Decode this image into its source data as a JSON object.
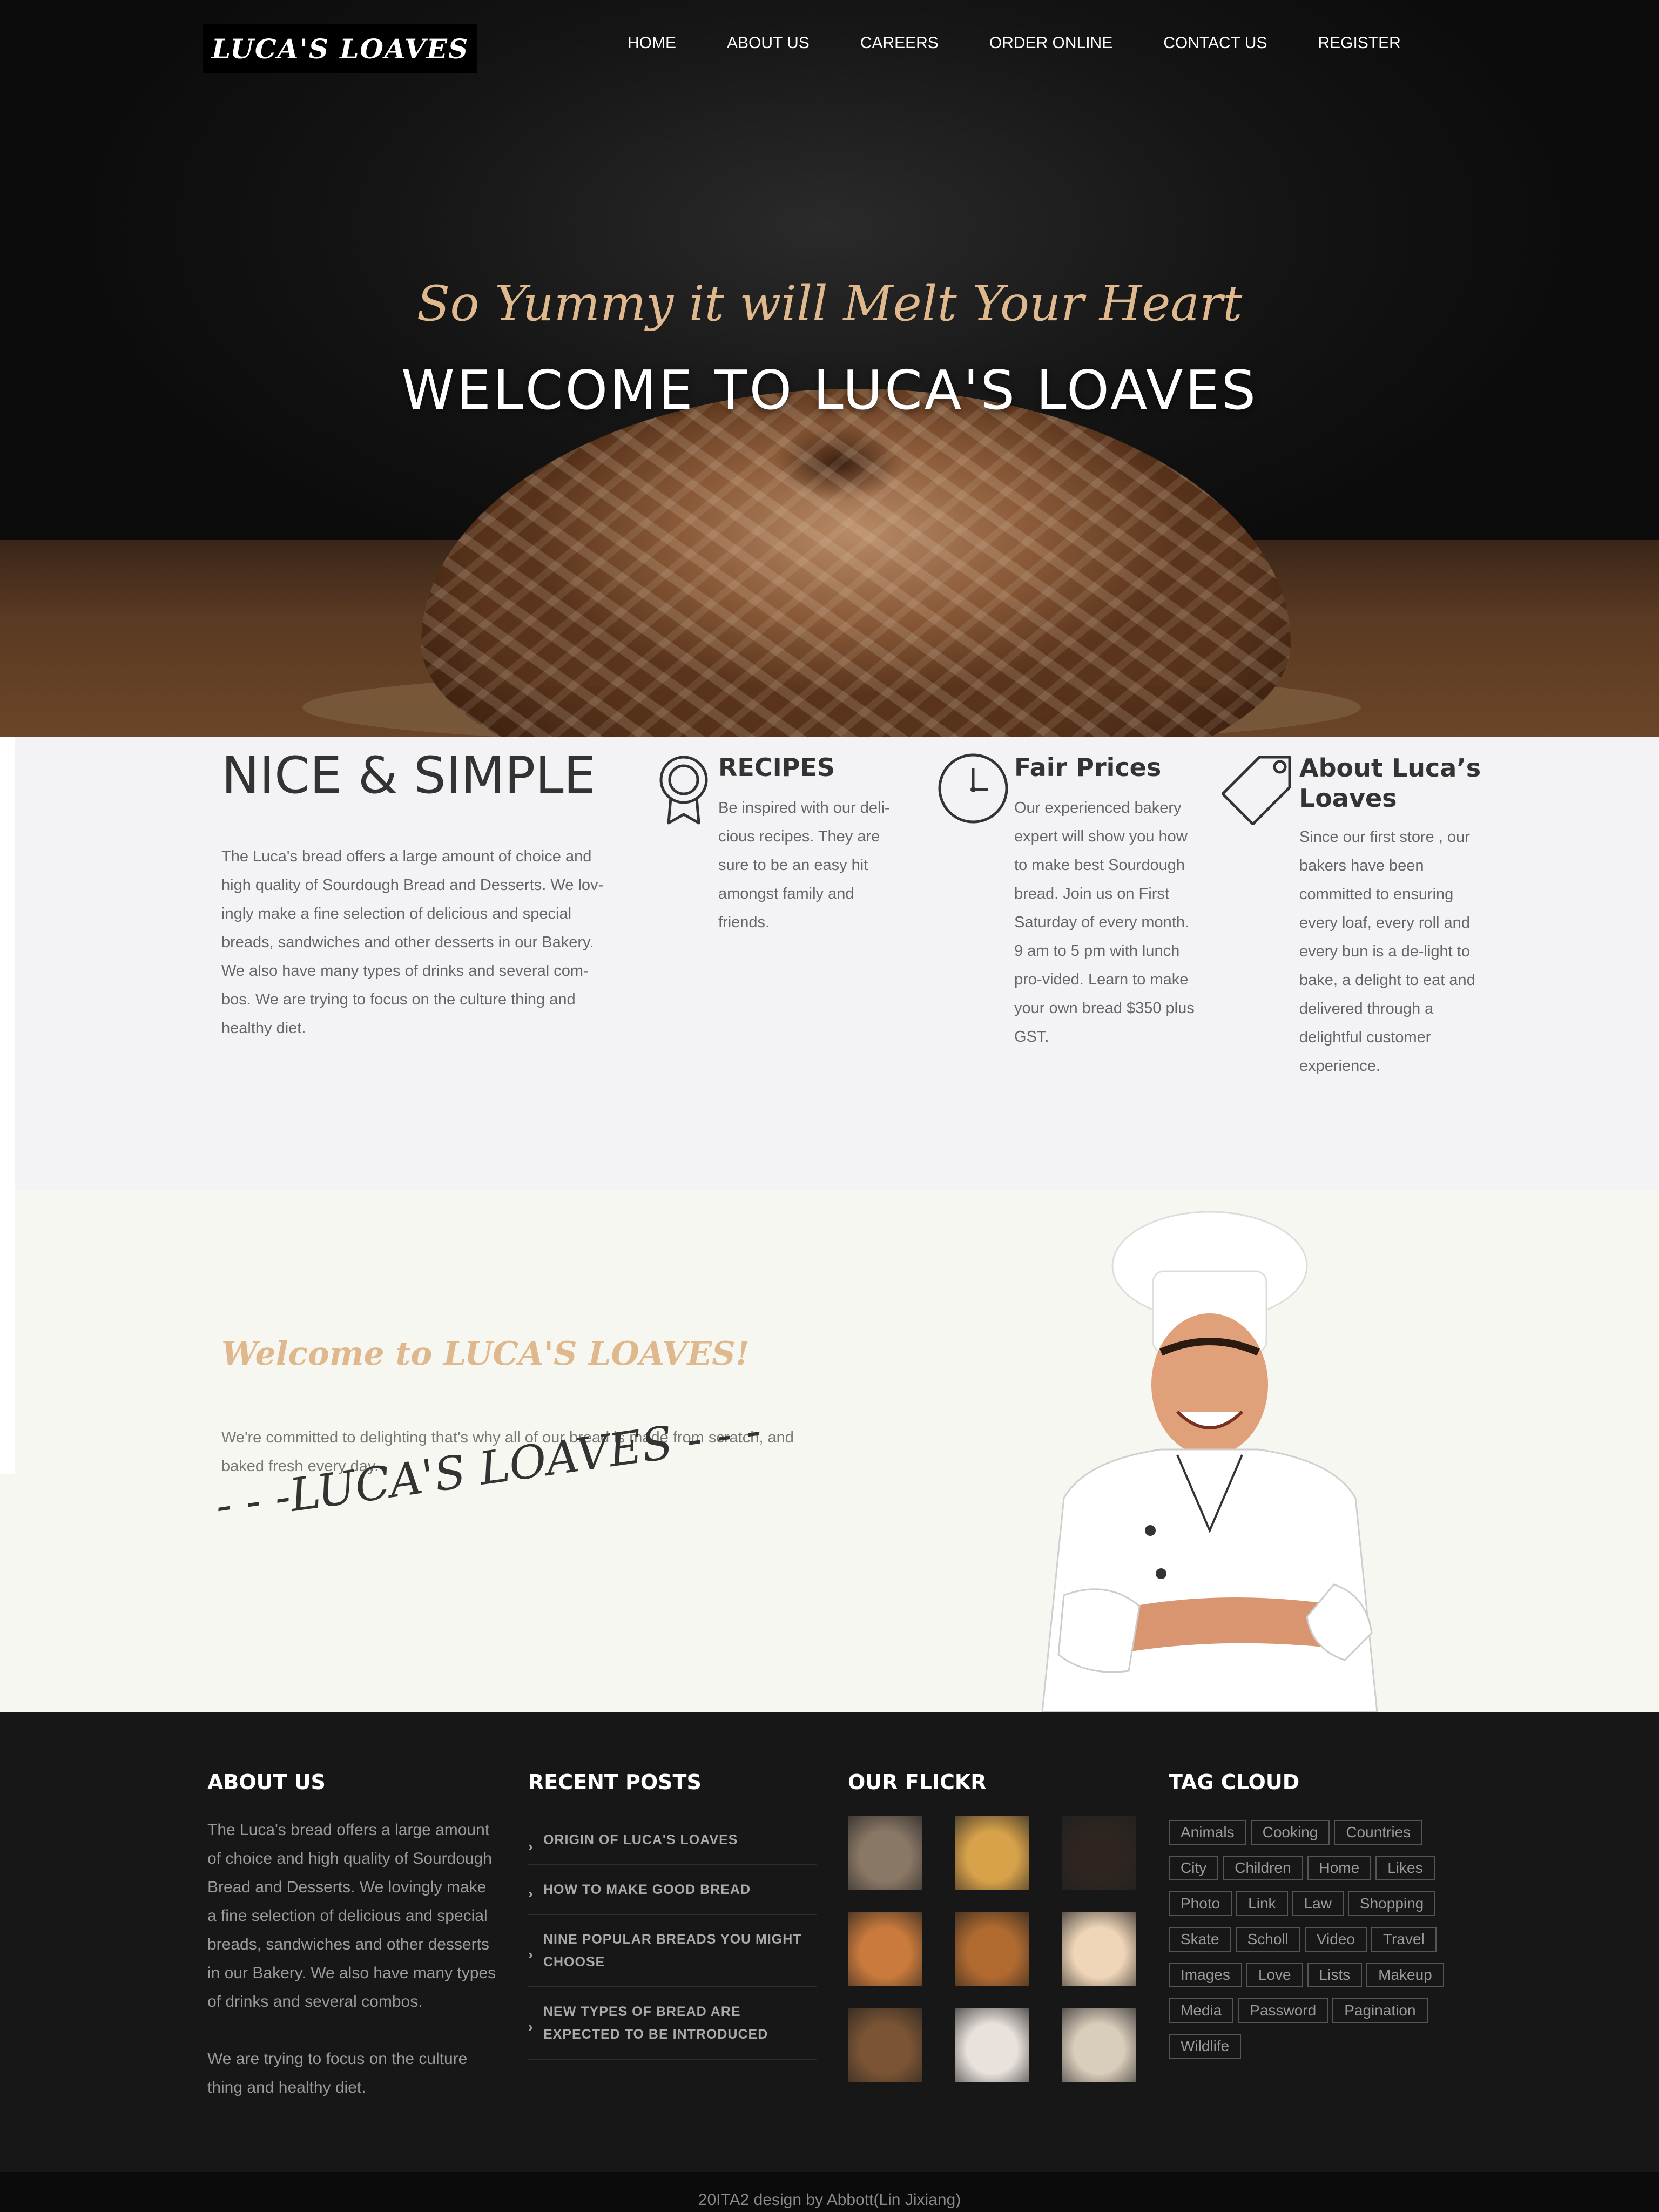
{
  "brand": {
    "logo_text": "LUCA'S LOAVES"
  },
  "nav": {
    "items": [
      "HOME",
      "ABOUT US",
      "CAREERS",
      "ORDER ONLINE",
      "CONTACT US",
      "REGISTER"
    ]
  },
  "hero": {
    "tagline": "So Yummy it will Melt Your Heart",
    "title": "WELCOME TO LUCA'S LOAVES"
  },
  "intro": {
    "title": "NICE & SIMPLE",
    "text": "The Luca's bread offers a large amount of choice and high quality of Sourdough Bread and Desserts. We lov-ingly make a fine selection of delicious and special breads, sandwiches and other desserts in our Bakery. We also have many types of drinks and several com-bos. We are trying to focus on the culture thing and healthy diet."
  },
  "features": [
    {
      "icon": "award-icon",
      "title": "RECIPES",
      "text": "Be inspired with our deli-cious recipes. They are sure to be an easy hit amongst family and friends."
    },
    {
      "icon": "clock-icon",
      "title": "Fair Prices",
      "text": "Our experienced bakery expert will show you how to make best Sourdough bread. Join us on First Saturday of every month. 9 am to 5 pm with lunch pro-vided. Learn to make your own bread $350 plus GST."
    },
    {
      "icon": "tag-icon",
      "title": "About Luca’s Loaves",
      "text": "Since our first store , our bakers have been committed to ensuring every loaf, every roll and every bun is a de-light to bake, a delight to eat and delivered through a delightful customer experience."
    }
  ],
  "chef": {
    "welcome": "Welcome to LUCA'S LOAVES!",
    "text": "We're committed to delighting that's why all of our bread is made from scratch, and baked fresh every day.",
    "signature": "- - -LUCA'S LOAVES - - -"
  },
  "footer": {
    "about_heading": "ABOUT US",
    "about_text_1": "The Luca's bread offers a large amount of choice and high quality of Sourdough Bread and Desserts. We lovingly make a fine selection of delicious and special breads, sandwiches and other desserts in our Bakery. We also have many types of drinks and several combos.",
    "about_text_2": "We are trying to focus on the culture thing and healthy diet.",
    "posts_heading": "RECENT POSTS",
    "posts": [
      "ORIGIN OF LUCA'S LOAVES",
      "HOW TO MAKE GOOD BREAD",
      "NINE POPULAR BREADS YOU MIGHT CHOOSE",
      "NEW TYPES OF BREAD ARE EXPECTED TO BE INTRODUCED"
    ],
    "flickr_heading": "OUR FLICKR",
    "flickr_colors": [
      "#8a7866",
      "#d8a24a",
      "#2e2520",
      "#c97a3c",
      "#b06a30",
      "#f0d6b8",
      "#7a5434",
      "#e9e2dc",
      "#d9cdbb"
    ],
    "tags_heading": "TAG CLOUD",
    "tags": [
      "Animals",
      "Cooking",
      "Countries",
      "City",
      "Children",
      "Home",
      "Likes",
      "Photo",
      "Link",
      "Law",
      "Shopping",
      "Skate",
      "Scholl",
      "Video",
      "Travel",
      "Images",
      "Love",
      "Lists",
      "Makeup",
      "Media",
      "Password",
      "Pagination",
      "Wildlife"
    ]
  },
  "credits": "20ITA2 design by Abbott(Lin Jixiang)",
  "colors": {
    "accent": "#e0b88e",
    "footer_bg": "#171717",
    "features_bg": "#f3f3f6"
  }
}
